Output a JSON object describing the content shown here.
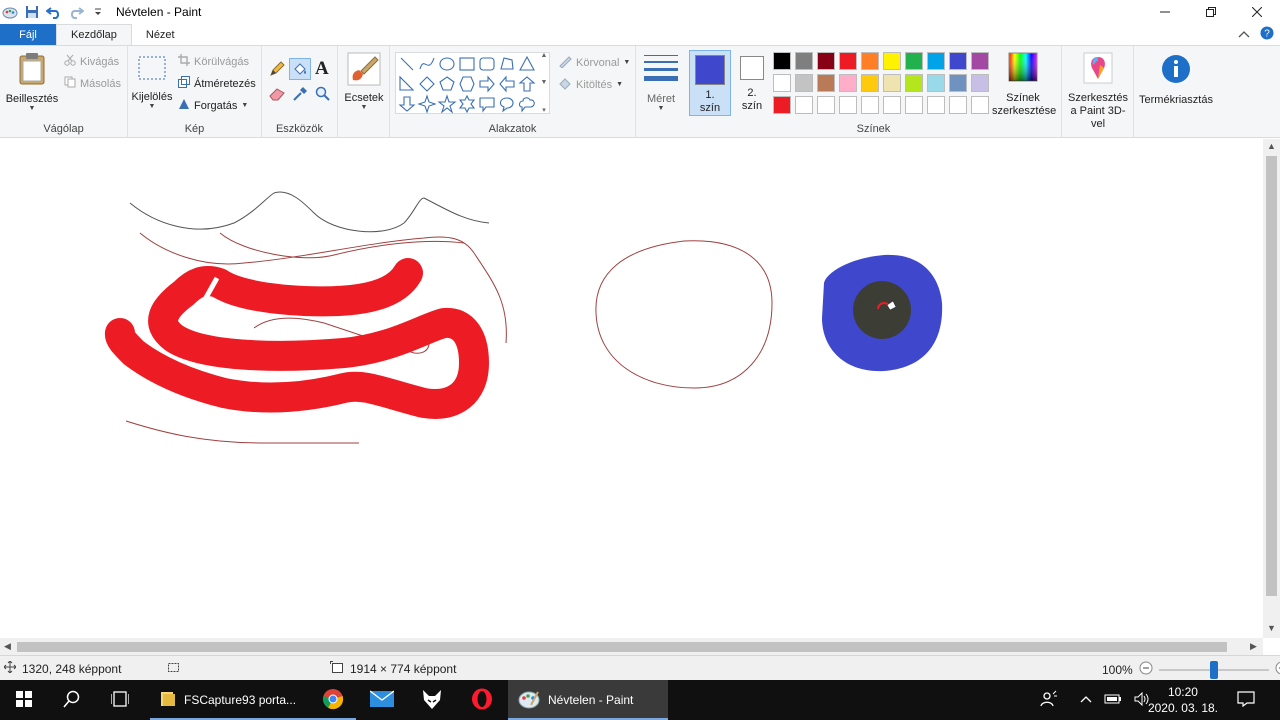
{
  "window": {
    "title": "Névtelen - Paint"
  },
  "tabs": {
    "file": "Fájl",
    "home": "Kezdőlap",
    "view": "Nézet"
  },
  "ribbon": {
    "clipboard": {
      "label": "Vágólap",
      "paste": "Beillesztés",
      "cut": "Kivágás",
      "copy": "Másolás"
    },
    "image": {
      "label": "Kép",
      "select": "Kijelölés",
      "crop": "Körülvágás",
      "resize": "Átméretezés",
      "rotate": "Forgatás"
    },
    "tools": {
      "label": "Eszközök"
    },
    "brushes": {
      "label": "Ecsetek"
    },
    "shapes": {
      "label": "Alakzatok",
      "outline": "Körvonal",
      "fill": "Kitöltés"
    },
    "size": {
      "label": "Méret"
    },
    "colors": {
      "label": "Színek",
      "color1": "1. szín",
      "color2": "2. szín",
      "color1_value": "#3f48cc",
      "color2_value": "#ffffff",
      "edit_colors": "Színek szerkesztése",
      "palette": [
        [
          "#000000",
          "#7f7f7f",
          "#880015",
          "#ed1c24",
          "#ff7f27",
          "#fff200",
          "#22b14c",
          "#00a2e8",
          "#3f48cc",
          "#a349a4"
        ],
        [
          "#ffffff",
          "#c3c3c3",
          "#b97a57",
          "#ffaec9",
          "#ffc90e",
          "#efe4b0",
          "#b5e61d",
          "#99d9ea",
          "#7092be",
          "#c8bfe7"
        ],
        [
          "#ed1c24",
          "#ffffff",
          "#ffffff",
          "#ffffff",
          "#ffffff",
          "#ffffff",
          "#ffffff",
          "#ffffff",
          "#ffffff",
          "#ffffff"
        ]
      ]
    },
    "paint3d": {
      "label": "Szerkesztés a Paint 3D-vel"
    },
    "product_alert": {
      "label": "Termékriasztás"
    }
  },
  "status": {
    "cursor_pos": "1320, 248 képpont",
    "image_size": "1914 × 774 képpont",
    "zoom": "100%",
    "zoom_slider_value": 0.5
  },
  "taskbar": {
    "fscapture": "FSCapture93 porta...",
    "paint": "Névtelen - Paint",
    "time": "10:20",
    "date": "2020. 03. 18."
  }
}
